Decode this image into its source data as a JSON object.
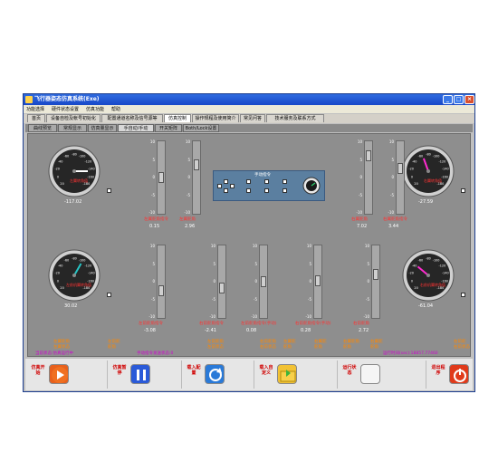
{
  "window": {
    "title": "飞行器姿态仿真系统(Exe)"
  },
  "menu": [
    "功能选择",
    "硬件状态设置",
    "仿真功能",
    "帮助"
  ],
  "tabs": [
    "首页",
    "设备自检及帐号初始化",
    "配置通道名称及信号源等",
    "仿真控制",
    "操作规程及使用简介",
    "常见问答",
    "技术服务及联系方式"
  ],
  "subtabs": [
    "曲线预览",
    "常规显示",
    "仿真量显示",
    "手自动/手动",
    "开关矩阵",
    "Both/Lock设置"
  ],
  "gauges": [
    {
      "label": "左翼转角值",
      "value": "-117.02",
      "angle": 90,
      "needle": "#ffffff"
    },
    {
      "label": "右翼转角值",
      "value": "-27.59",
      "angle": -20,
      "needle": "#ff2bd0"
    },
    {
      "label": "左前机翼转角值",
      "value": "30.02",
      "angle": 30,
      "needle": "#26c4c4"
    },
    {
      "label": "右前机翼转角值",
      "value": "-61.04",
      "angle": -50,
      "needle": "#ff2bd0"
    }
  ],
  "gauge_ticks": [
    "20",
    "0",
    "-20",
    "-40",
    "-60",
    "-80",
    "-100",
    "-120",
    "-140",
    "-160",
    "-180"
  ],
  "slider_ticks": [
    "10",
    "5",
    "0",
    "-5",
    "-10"
  ],
  "top_sliders": [
    {
      "label": "左翼舵角指令",
      "value": "0.15",
      "level": 0.5
    },
    {
      "label": "左翼舵角",
      "value": "2.96",
      "level": 0.7
    },
    {
      "label": "右翼舵角",
      "value": "7.02",
      "level": 0.85
    },
    {
      "label": "右翼舵角指令",
      "value": "3.44",
      "level": 0.65
    }
  ],
  "bottom_sliders": [
    {
      "label": "左前舵角指令",
      "value": "-3.08",
      "level": 0.35
    },
    {
      "label": "右前舵角指令",
      "value": "-2.41",
      "level": 0.4
    },
    {
      "label": "左前舵角指令(手动)",
      "value": "0.08",
      "level": 0.5
    },
    {
      "label": "右前舵角指令(手动)",
      "value": "0.28",
      "level": 0.52
    },
    {
      "label": "右前舵角",
      "value": "2.72",
      "level": 0.62
    }
  ],
  "control_box": {
    "title": "手动指令"
  },
  "status_orange": [
    {
      "top": "左翼舵角",
      "bottom": "左翼状态"
    },
    {
      "top": "左前舵",
      "bottom": "舵角"
    },
    {
      "top": "左前舵角",
      "bottom": "左前状态"
    },
    {
      "top": "右前舵角",
      "bottom": "右前状态"
    },
    {
      "top": "左翼舵",
      "bottom": "舵角"
    },
    {
      "top": "右翼舵",
      "bottom": "舵角"
    },
    {
      "top": "右翼舵角",
      "bottom": "舵角"
    },
    {
      "top": "右翼舵",
      "bottom": "舵角"
    },
    {
      "top": "右前舵",
      "bottom": "右前状态"
    }
  ],
  "status_left": "当前状态:仿真运行中",
  "status_mid": "手动指令发送状态:0",
  "status_right": "运行时间(sec):18857.77460",
  "bottom_buttons": [
    {
      "label": "仿真开始",
      "icon": "play-icon",
      "color": "#e8601c"
    },
    {
      "label": "仿真暂停",
      "icon": "pause-icon",
      "color": "#2a5ad8"
    },
    {
      "label": "载入配置",
      "icon": "refresh-icon",
      "color": "#2a7ad8"
    },
    {
      "label": "载入自定义",
      "icon": "folder-icon",
      "color": "#f2c234"
    },
    {
      "label": "运行状态",
      "icon": "status-icon",
      "color": "#f5f5f5"
    },
    {
      "label": "退出程序",
      "icon": "power-icon",
      "color": "#e03a1a"
    }
  ]
}
